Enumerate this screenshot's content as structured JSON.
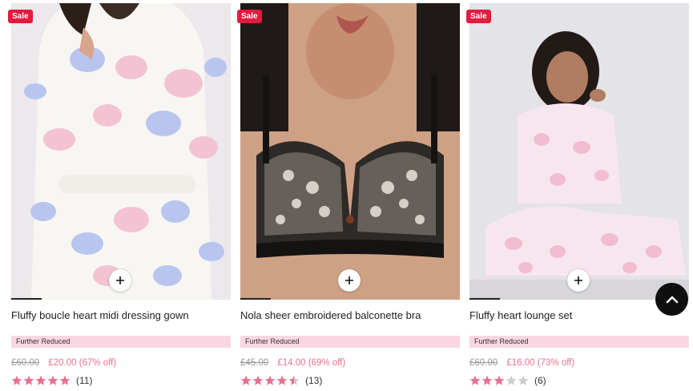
{
  "products": [
    {
      "sale_badge": "Sale",
      "title": "Fluffy boucle heart midi dressing gown",
      "promo": "Further Reduced",
      "was_price": "£60.00",
      "now_price": "£20.00 (67% off)",
      "rating": 5,
      "review_count": "(11)"
    },
    {
      "sale_badge": "Sale",
      "title": "Nola sheer embroidered balconette bra",
      "promo": "Further Reduced",
      "was_price": "£45.00",
      "now_price": "£14.00 (69% off)",
      "rating": 4.5,
      "review_count": "(13)"
    },
    {
      "sale_badge": "Sale",
      "title": "Fluffy heart lounge set",
      "promo": "Further Reduced",
      "was_price": "£60.00",
      "now_price": "£16.00 (73% off)",
      "rating": 3,
      "review_count": "(6)"
    }
  ],
  "icons": {
    "add": "plus-icon",
    "back_to_top": "chevron-up-icon",
    "star": "star-icon"
  },
  "colors": {
    "sale_badge": "#e31b3f",
    "promo_bg": "#f8d7e1",
    "now_price": "#e8718f",
    "star_fill": "#e8718f",
    "star_empty": "#cccccc"
  }
}
